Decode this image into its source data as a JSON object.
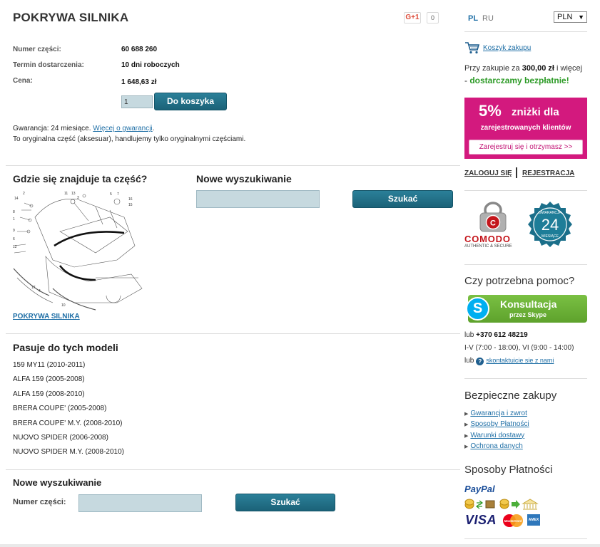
{
  "product": {
    "title": "POKRYWA SILNIKA",
    "gplus_label": "G+1",
    "gplus_count": "0",
    "part_number_label": "Numer części:",
    "part_number": "60 688 260",
    "delivery_label": "Termin dostarczenia:",
    "delivery": "10 dni roboczych",
    "price_label": "Cena:",
    "price": "1 648,63 zł",
    "quantity": "1",
    "add_to_cart": "Do koszyka",
    "warranty_text": "Gwarancja: 24 miesiące. ",
    "warranty_link": "Więcej o gwarancji",
    "warranty_dot": ".",
    "original_text": "To oryginalna część (aksesuar), handlujemy tylko oryginalnymi częściami."
  },
  "location": {
    "heading": "Gdzie się znajduje ta część?",
    "diagram_link": "POKRYWA SILNIKA",
    "diagram_numbers": [
      "2",
      "11",
      "13",
      "3",
      "5",
      "7",
      "16",
      "15",
      "14",
      "8",
      "1",
      "9",
      "6",
      "12",
      "4",
      "10",
      "17"
    ]
  },
  "new_search_top": {
    "heading": "Nowe wyszukiwanie",
    "button": "Szukać",
    "value": ""
  },
  "models": {
    "heading": "Pasuje do tych modeli",
    "items": [
      "159 MY11 (2010-2011)",
      "ALFA 159 (2005-2008)",
      "ALFA 159 (2008-2010)",
      "BRERA COUPE' (2005-2008)",
      "BRERA COUPE' M.Y. (2008-2010)",
      "NUOVO SPIDER (2006-2008)",
      "NUOVO SPIDER M.Y. (2008-2010)"
    ]
  },
  "new_search_bottom": {
    "heading": "Nowe wyszukiwanie",
    "label": "Numer części:",
    "button": "Szukać",
    "value": ""
  },
  "sidebar": {
    "lang_pl": "PL",
    "lang_ru": "RU",
    "currency": "PLN",
    "cart_link": "Koszyk zakupu",
    "free_prefix": "Przy zakupie za ",
    "free_amount": "300,00 zł",
    "free_suffix": " i więcej",
    "free_dash": "- ",
    "free_bold": "dostarczamy bezpłatnie!",
    "promo_pct": "5%",
    "promo_disc": "zniżki dla",
    "promo_sub": "zarejestrowanych klientów",
    "promo_btn": "Zarejestruj się i otrzymasz >>",
    "login": "ZALOGUJ SIĘ",
    "register": "REJESTRACJA",
    "comodo_word": "COMODO",
    "comodo_sub": "AUTHENTIC & SECURE",
    "seal_top": "GWARANCJA",
    "seal_num": "24",
    "seal_bottom": "MIESIĄCE",
    "help_title": "Czy potrzebna pomoc?",
    "skype_t1": "Konsultacja",
    "skype_t2": "przez Skype",
    "phone_prefix": "lub ",
    "phone": "+370 612 48219",
    "hours": "I-V (7:00 - 18:00), VI (9:00 - 14:00)",
    "contact_prefix": "lub",
    "contact_link": "skontaktuicie sie z nami",
    "secure_title": "Bezpieczne zakupy",
    "secure_items": [
      "Gwarancja i zwrot",
      "Sposoby Płatności",
      "Warunki dostawy",
      "Ochrona danych"
    ],
    "pay_title": "Sposoby Płatności",
    "paypal": "PayPal",
    "visa": "VISA",
    "mastercard": "MasterCard",
    "amex": "AMEX"
  }
}
